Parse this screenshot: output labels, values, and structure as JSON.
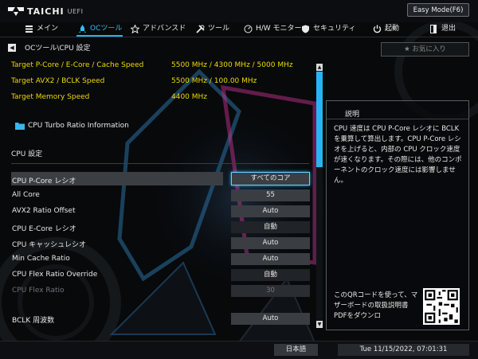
{
  "header": {
    "brand": "TAICHI",
    "brand_sub": "UEFI",
    "easy_mode_label": "Easy Mode(F6)"
  },
  "nav": {
    "items": [
      {
        "label": "メイン",
        "icon": "menu-icon"
      },
      {
        "label": "OCツール",
        "icon": "rocket-icon",
        "active": true
      },
      {
        "label": "アドバンスド",
        "icon": "star-icon"
      },
      {
        "label": "ツール",
        "icon": "tools-icon"
      },
      {
        "label": "H/W モニター",
        "icon": "monitor-icon"
      },
      {
        "label": "セキュリティ",
        "icon": "shield-icon"
      },
      {
        "label": "起動",
        "icon": "power-icon"
      },
      {
        "label": "退出",
        "icon": "exit-icon"
      }
    ]
  },
  "breadcrumb": "OCツール\\CPU 設定",
  "favorite_label": "お気に入り",
  "info": [
    {
      "label": "Target P-Core / E-Core / Cache Speed",
      "value": "5500 MHz / 4300 MHz / 5000 MHz"
    },
    {
      "label": "Target AVX2 / BCLK Speed",
      "value": "5500 MHz / 100.00 MHz"
    },
    {
      "label": "Target Memory Speed",
      "value": "4400 MHz"
    }
  ],
  "submenu_label": "CPU Turbo Ratio Information",
  "section_title": "CPU 設定",
  "settings": [
    {
      "label": "CPU P-Core レシオ",
      "value": "すべてのコア"
    },
    {
      "label": " All Core",
      "value": "55"
    },
    {
      "label": "AVX2 Ratio Offset",
      "value": "Auto"
    },
    {
      "label": "CPU E-Core レシオ",
      "value": "自動"
    },
    {
      "label": "CPU  キャッシュレシオ",
      "value": "Auto"
    },
    {
      "label": "Min Cache  Ratio",
      "value": "Auto"
    },
    {
      "label": "CPU Flex  Ratio Override",
      "value": "自動"
    },
    {
      "label": "CPU Flex  Ratio",
      "value": "30"
    },
    {
      "label": "BCLK 周波数",
      "value": "Auto"
    }
  ],
  "description": {
    "title": "説明",
    "text": "CPU 速度は CPU P-Core レシオに BCLK を乗算して算出します。CPU P-Core レシオを上げると、内部の CPU クロック速度が速くなります。その際には、他のコンポーネントのクロック速度には影響しません。",
    "qr_text": "このQRコードを使って、マザーボードの取扱説明書PDFをダウンロ"
  },
  "footer": {
    "language": "日本語",
    "datetime": "Tue 11/15/2022, 07:01:31"
  },
  "colors": {
    "accent": "#26b3f1",
    "info_text": "#f0d800"
  }
}
